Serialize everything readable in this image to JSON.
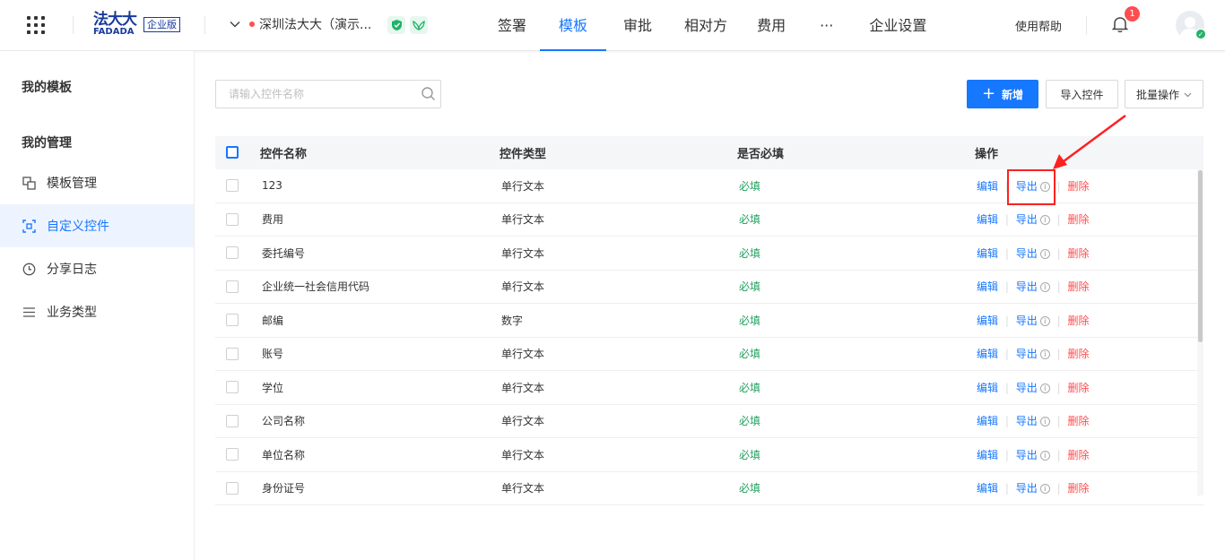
{
  "topbar": {
    "logo_cn": "法大大",
    "logo_en": "FADADA",
    "edition": "企业版",
    "company": "深圳法大大（演示...",
    "nav": [
      "签署",
      "模板",
      "审批",
      "相对方",
      "费用",
      "···",
      "企业设置"
    ],
    "active_nav": "模板",
    "help": "使用帮助",
    "notification_count": "1"
  },
  "sidebar": {
    "section1": "我的模板",
    "section2": "我的管理",
    "items": [
      {
        "label": "模板管理",
        "icon": "template-icon"
      },
      {
        "label": "自定义控件",
        "icon": "custom-control-icon"
      },
      {
        "label": "分享日志",
        "icon": "clock-icon"
      },
      {
        "label": "业务类型",
        "icon": "list-icon"
      }
    ],
    "active_item": "自定义控件"
  },
  "toolbar": {
    "search_placeholder": "请输入控件名称",
    "new_label": "新增",
    "import_label": "导入控件",
    "batch_label": "批量操作"
  },
  "table": {
    "headers": {
      "name": "控件名称",
      "type": "控件类型",
      "required": "是否必填",
      "actions": "操作"
    },
    "action_labels": {
      "edit": "编辑",
      "export": "导出",
      "delete": "删除"
    },
    "rows": [
      {
        "name": "123",
        "type": "单行文本",
        "required": "必填"
      },
      {
        "name": "费用",
        "type": "单行文本",
        "required": "必填"
      },
      {
        "name": "委托编号",
        "type": "单行文本",
        "required": "必填"
      },
      {
        "name": "企业统一社会信用代码",
        "type": "单行文本",
        "required": "必填"
      },
      {
        "name": "邮编",
        "type": "数字",
        "required": "必填"
      },
      {
        "name": "账号",
        "type": "单行文本",
        "required": "必填"
      },
      {
        "name": "学位",
        "type": "单行文本",
        "required": "必填"
      },
      {
        "name": "公司名称",
        "type": "单行文本",
        "required": "必填"
      },
      {
        "name": "单位名称",
        "type": "单行文本",
        "required": "必填"
      },
      {
        "name": "身份证号",
        "type": "单行文本",
        "required": "必填"
      }
    ]
  },
  "colors": {
    "primary": "#1677ff",
    "danger": "#ff4d4f",
    "success": "#20a05e",
    "annotation": "#ff2020"
  }
}
